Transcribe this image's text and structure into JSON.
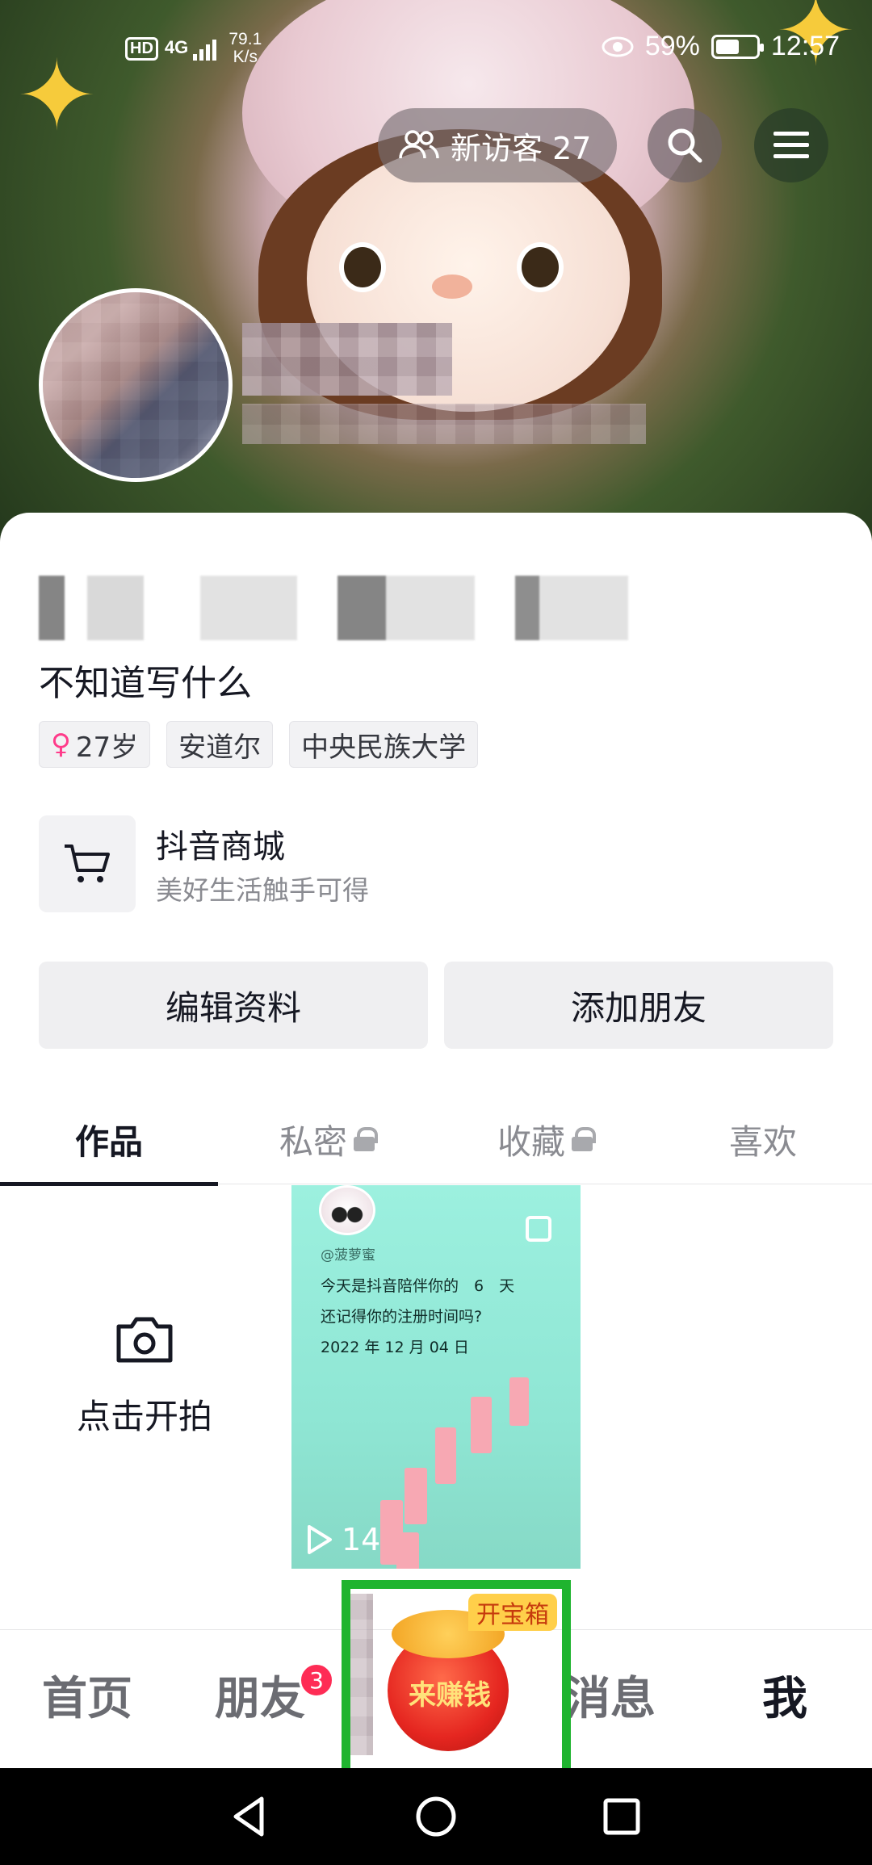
{
  "status_bar": {
    "hd": "HD",
    "network": "4G",
    "net_speed_value": "79.1",
    "net_speed_unit": "K/s",
    "battery": "59%",
    "battery_level": 0.59,
    "time": "12:57"
  },
  "header": {
    "new_visitors": "新访客 27"
  },
  "profile": {
    "stats": [
      {
        "value": "0",
        "label": "获赞"
      },
      {
        "value": "",
        "label": "朋友"
      },
      {
        "value": "42",
        "label": "关注"
      },
      {
        "value": "5",
        "label": "粉丝"
      }
    ],
    "bio": "不知道写什么",
    "tags": [
      "27岁",
      "安道尔",
      "中央民族大学"
    ]
  },
  "shop": {
    "title": "抖音商城",
    "subtitle": "美好生活触手可得"
  },
  "actions": {
    "edit_profile": "编辑资料",
    "add_friend": "添加朋友"
  },
  "tabs": [
    {
      "label": "作品",
      "locked": false,
      "active": true
    },
    {
      "label": "私密",
      "locked": true,
      "active": false
    },
    {
      "label": "收藏",
      "locked": true,
      "active": false
    },
    {
      "label": "喜欢",
      "locked": false,
      "active": false
    }
  ],
  "grid": {
    "capture_label": "点击开拍",
    "video": {
      "handle": "@菠萝蜜",
      "line1": "今天是抖音陪伴你的　6　天",
      "line2": "还记得你的注册时间吗?",
      "line3": "2022 年 12 月 04 日",
      "plays": "14"
    }
  },
  "bottom_nav": {
    "home": "首页",
    "friends": "朋友",
    "friends_badge": "3",
    "earn_tag": "开宝箱",
    "earn_label": "来赚钱",
    "messages": "消息",
    "me": "我"
  },
  "colors": {
    "accent_red": "#fe2c55",
    "highlight_green": "#1fb42f",
    "text_primary": "#161823",
    "text_secondary": "#8a8b91"
  }
}
